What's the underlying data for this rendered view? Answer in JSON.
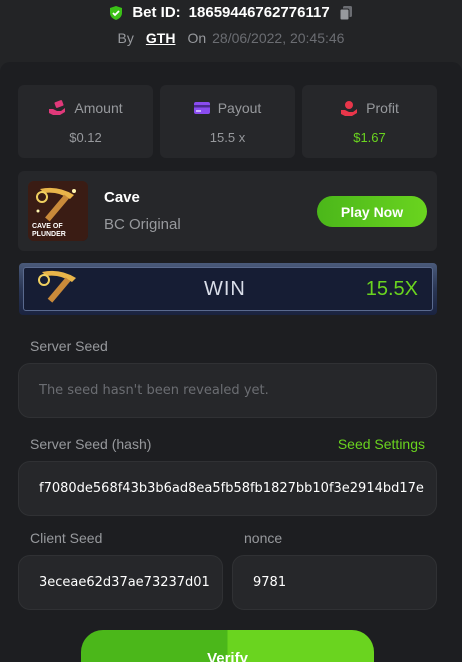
{
  "header": {
    "bet_id_label": "Bet ID:",
    "bet_id": "18659446762776117",
    "by_label": "By",
    "user": "GTH",
    "on_label": "On",
    "datetime": "28/06/2022, 20:45:46"
  },
  "stats": {
    "amount": {
      "label": "Amount",
      "value": "$0.12",
      "icon": "money-hand-icon"
    },
    "payout": {
      "label": "Payout",
      "value": "15.5 x",
      "icon": "card-icon"
    },
    "profit": {
      "label": "Profit",
      "value": "$1.67",
      "icon": "profit-hand-icon"
    }
  },
  "game": {
    "name": "Cave",
    "subtitle": "BC Original",
    "thumb_text_1": "CAVE OF",
    "thumb_text_2": "PLUNDER",
    "play_label": "Play Now"
  },
  "result": {
    "label": "WIN",
    "multiplier": "15.5X"
  },
  "seeds": {
    "server_seed_label": "Server Seed",
    "server_seed_placeholder": "The seed hasn't been revealed yet.",
    "server_hash_label": "Server Seed (hash)",
    "seed_settings_label": "Seed Settings",
    "server_hash": "f7080de568f43b3b6ad8ea5fb58fb1827bb10f3e2914bd17e",
    "client_seed_label": "Client Seed",
    "client_seed": "3eceae62d37ae73237d01",
    "nonce_label": "nonce",
    "nonce": "9781"
  },
  "verify_label": "Verify",
  "colors": {
    "accent_green": "#6ad41f",
    "panel_bg": "#1d1e21",
    "card_bg": "#26272a",
    "muted_text": "#97999d"
  }
}
